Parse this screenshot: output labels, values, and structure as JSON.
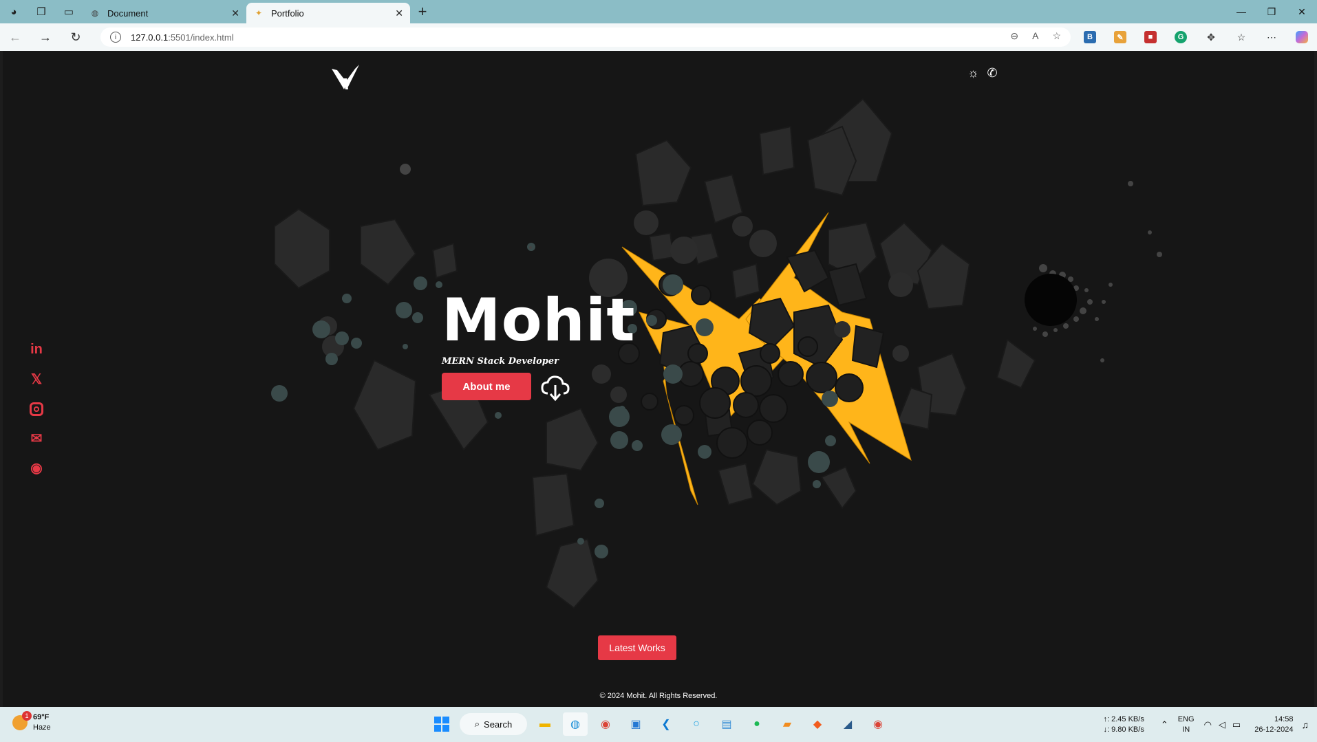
{
  "browser": {
    "tabs": [
      {
        "title": "Document",
        "active": false
      },
      {
        "title": "Portfolio",
        "active": true
      }
    ],
    "url_host": "127.0.0.1",
    "url_rest": ":5501/index.html"
  },
  "page": {
    "name": "Mohit",
    "subtitle": "MERN Stack Developer",
    "about_button": "About me",
    "works_button": "Latest Works",
    "footer": "© 2024 Mohit. All Rights Reserved.",
    "social": [
      "linkedin-icon",
      "x-icon",
      "instagram-icon",
      "mail-icon",
      "github-icon"
    ],
    "accent_color": "#e63946",
    "background_color": "#161616"
  },
  "taskbar": {
    "weather_temp": "69°F",
    "weather_desc": "Haze",
    "weather_badge": "1",
    "search_label": "Search",
    "net_up": "↑: 2.45 KB/s",
    "net_down": "↓: 9.80 KB/s",
    "lang": "ENG",
    "region": "IN",
    "time": "14:58",
    "date": "26-12-2024"
  }
}
